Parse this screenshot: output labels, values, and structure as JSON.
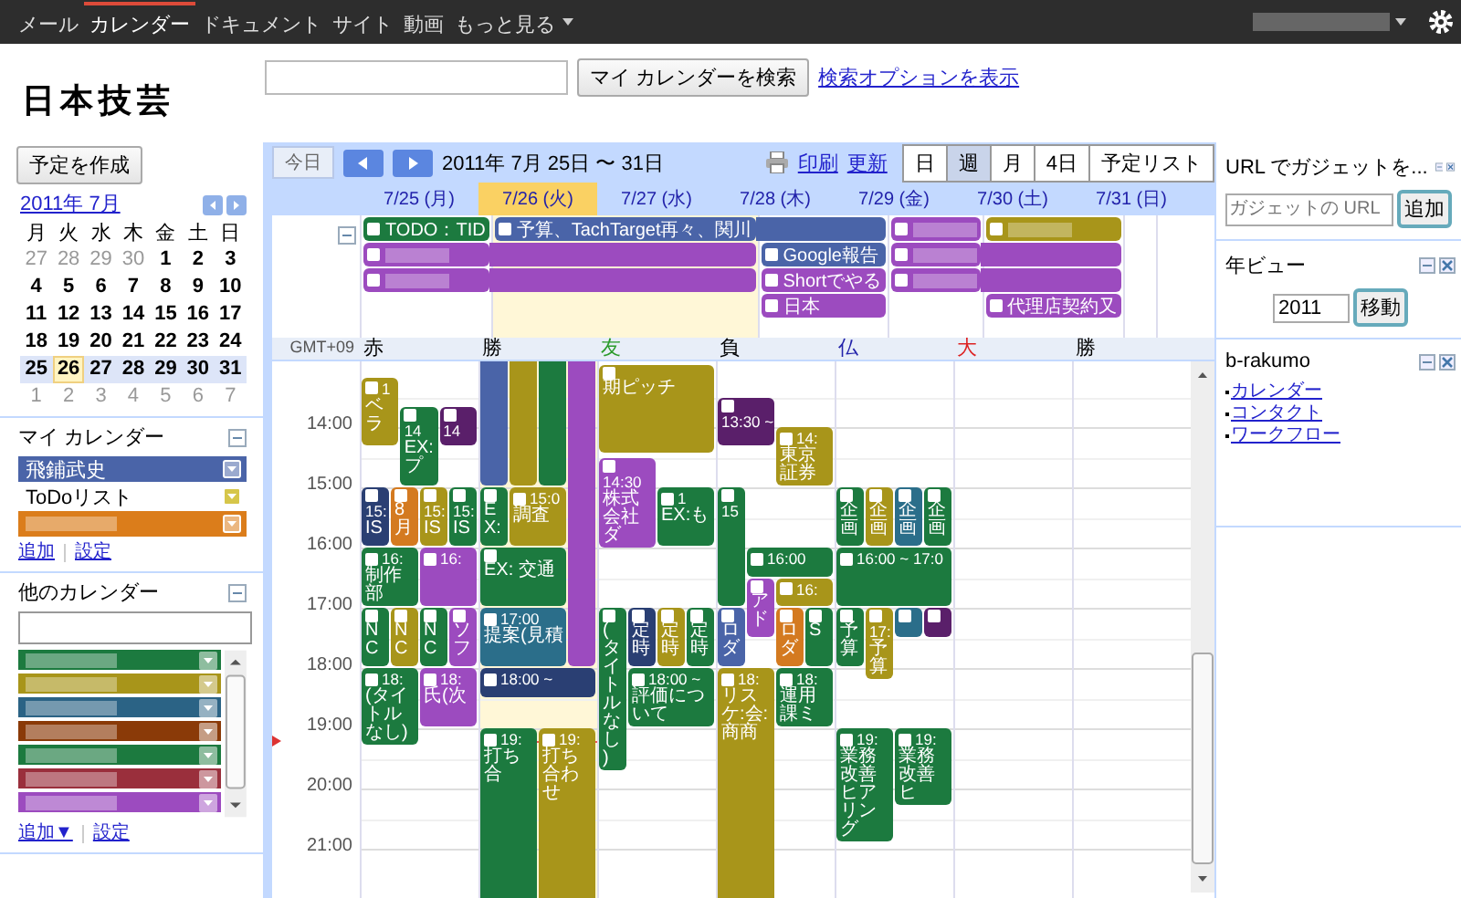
{
  "topbar": {
    "links": [
      {
        "label": "メール",
        "selected": false
      },
      {
        "label": "カレンダー",
        "selected": true
      },
      {
        "label": "ドキュメント",
        "selected": false
      },
      {
        "label": "サイト",
        "selected": false
      },
      {
        "label": "動画",
        "selected": false
      },
      {
        "label": "もっと見る",
        "selected": false
      }
    ]
  },
  "header": {
    "logo": "日本技芸",
    "search_button": "マイ カレンダーを検索",
    "search_options": "検索オプションを表示"
  },
  "sidebar": {
    "create_button": "予定を作成",
    "mini_calendar": {
      "title": "2011年 7月",
      "weekdays": [
        "月",
        "火",
        "水",
        "木",
        "金",
        "土",
        "日"
      ],
      "weeks": [
        {
          "selected": false,
          "days": [
            {
              "d": "27",
              "out": true,
              "today": false
            },
            {
              "d": "28",
              "out": true,
              "today": false
            },
            {
              "d": "29",
              "out": true,
              "today": false
            },
            {
              "d": "30",
              "out": true,
              "today": false
            },
            {
              "d": "1",
              "out": false,
              "today": false
            },
            {
              "d": "2",
              "out": false,
              "today": false
            },
            {
              "d": "3",
              "out": false,
              "today": false
            }
          ]
        },
        {
          "selected": false,
          "days": [
            {
              "d": "4",
              "out": false,
              "today": false
            },
            {
              "d": "5",
              "out": false,
              "today": false
            },
            {
              "d": "6",
              "out": false,
              "today": false
            },
            {
              "d": "7",
              "out": false,
              "today": false
            },
            {
              "d": "8",
              "out": false,
              "today": false
            },
            {
              "d": "9",
              "out": false,
              "today": false
            },
            {
              "d": "10",
              "out": false,
              "today": false
            }
          ]
        },
        {
          "selected": false,
          "days": [
            {
              "d": "11",
              "out": false,
              "today": false
            },
            {
              "d": "12",
              "out": false,
              "today": false
            },
            {
              "d": "13",
              "out": false,
              "today": false
            },
            {
              "d": "14",
              "out": false,
              "today": false
            },
            {
              "d": "15",
              "out": false,
              "today": false
            },
            {
              "d": "16",
              "out": false,
              "today": false
            },
            {
              "d": "17",
              "out": false,
              "today": false
            }
          ]
        },
        {
          "selected": false,
          "days": [
            {
              "d": "18",
              "out": false,
              "today": false
            },
            {
              "d": "19",
              "out": false,
              "today": false
            },
            {
              "d": "20",
              "out": false,
              "today": false
            },
            {
              "d": "21",
              "out": false,
              "today": false
            },
            {
              "d": "22",
              "out": false,
              "today": false
            },
            {
              "d": "23",
              "out": false,
              "today": false
            },
            {
              "d": "24",
              "out": false,
              "today": false
            }
          ]
        },
        {
          "selected": true,
          "days": [
            {
              "d": "25",
              "out": false,
              "today": false
            },
            {
              "d": "26",
              "out": false,
              "today": true
            },
            {
              "d": "27",
              "out": false,
              "today": false
            },
            {
              "d": "28",
              "out": false,
              "today": false
            },
            {
              "d": "29",
              "out": false,
              "today": false
            },
            {
              "d": "30",
              "out": false,
              "today": false
            },
            {
              "d": "31",
              "out": false,
              "today": false
            }
          ]
        },
        {
          "selected": false,
          "days": [
            {
              "d": "1",
              "out": true,
              "today": false
            },
            {
              "d": "2",
              "out": true,
              "today": false
            },
            {
              "d": "3",
              "out": true,
              "today": false
            },
            {
              "d": "4",
              "out": true,
              "today": false
            },
            {
              "d": "5",
              "out": true,
              "today": false
            },
            {
              "d": "6",
              "out": true,
              "today": false
            },
            {
              "d": "7",
              "out": true,
              "today": false
            }
          ]
        }
      ]
    },
    "my_calendars": {
      "title": "マイ カレンダー",
      "items": [
        {
          "name": "飛鋪武史",
          "color": "#4a64a8",
          "filled": true
        },
        {
          "name": "ToDoリスト",
          "color": "#d6c64a",
          "filled": false
        },
        {
          "color": "#db7d1b",
          "filled": true
        }
      ],
      "links": [
        "追加",
        "設定"
      ]
    },
    "other_calendars": {
      "title": "他のカレンダー",
      "items": [
        {
          "color": "#1c7a3f"
        },
        {
          "color": "#a8951a"
        },
        {
          "color": "#2b6385"
        },
        {
          "color": "#8a3a08"
        },
        {
          "color": "#1c7a3f"
        },
        {
          "color": "#9a2f3c"
        },
        {
          "color": "#9c4bbf"
        }
      ],
      "links": [
        "追加▼",
        "設定"
      ]
    }
  },
  "toolbar": {
    "today": "今日",
    "range": "2011年 7月 25日 〜 31日",
    "print": "印刷",
    "refresh": "更新",
    "views": [
      {
        "label": "日",
        "selected": false
      },
      {
        "label": "週",
        "selected": true
      },
      {
        "label": "月",
        "selected": false
      },
      {
        "label": "4日",
        "selected": false
      },
      {
        "label": "予定リスト",
        "selected": false
      }
    ]
  },
  "week": {
    "timezone": "GMT+09",
    "hours": [
      "14:00",
      "15:00",
      "16:00",
      "17:00",
      "18:00",
      "19:00",
      "20:00",
      "21:00"
    ],
    "days": [
      {
        "label": "7/25 (月)",
        "today": false,
        "rokuyo": {
          "text": "赤",
          "color": "#000000"
        },
        "allday": [
          {
            "kind": "event",
            "title": "TODO：TID",
            "color": "#1c7a3f",
            "continued": false
          },
          {
            "kind": "event",
            "color": "#9c4bbf",
            "continued": false
          },
          {
            "kind": "event",
            "color": "#9c4bbf",
            "continued": false
          }
        ],
        "events": [
          {
            "time": "1",
            "title": "ベラ",
            "color": "#a8951a"
          },
          {
            "time": "14",
            "title": "EX:プ",
            "color": "#1c7a3f"
          },
          {
            "time": "14",
            "color": "#5a1f6a"
          },
          {
            "time": "15:",
            "title": "IS",
            "color": "#2a3f73"
          },
          {
            "title": "8月",
            "color": "#d47a20"
          },
          {
            "time": "15:",
            "title": "IS",
            "color": "#a8951a"
          },
          {
            "time": "15:",
            "title": "IS",
            "color": "#1c7a3f"
          },
          {
            "time": "16:",
            "title": "制作部",
            "color": "#1c7a3f"
          },
          {
            "time": "16:",
            "color": "#9c4bbf"
          },
          {
            "title": "NC",
            "color": "#1c7a3f"
          },
          {
            "title": "NC",
            "color": "#a8951a"
          },
          {
            "title": "NC",
            "color": "#1c7a3f"
          },
          {
            "title": "ソフ",
            "color": "#9c4bbf"
          },
          {
            "time": "18:",
            "title": "(タイトルなし)",
            "color": "#1c7a3f"
          },
          {
            "time": "18:",
            "title": "氏(次",
            "color": "#9c4bbf"
          }
        ]
      },
      {
        "label": "7/26 (火)",
        "today": true,
        "rokuyo": {
          "text": "勝",
          "color": "#000000"
        },
        "allday": [
          {
            "kind": "event",
            "title": "予算、TachTarget再々、関川",
            "color": "#4a64a8",
            "continued": false
          },
          {
            "kind": "event",
            "color": "#9c4bbf",
            "continued": true
          },
          {
            "kind": "event",
            "color": "#9c4bbf",
            "continued": true
          }
        ],
        "events": [
          {
            "color": "#4a64a8"
          },
          {
            "color": "#a8951a"
          },
          {
            "color": "#1c7a3f"
          },
          {
            "color": "#9c4bbf"
          },
          {
            "title": "EX:",
            "color": "#1c7a3f"
          },
          {
            "time": "15:0",
            "title": "調査",
            "color": "#a8951a"
          },
          {
            "title": "EX: 交通",
            "color": "#1c7a3f"
          },
          {
            "time": "17:00",
            "title": "提案(見積",
            "color": "#2b6e8a"
          },
          {
            "time": "18:00 ~",
            "color": "#2a3f73"
          },
          {
            "time": "19:",
            "title": "打ち合",
            "color": "#1c7a3f"
          },
          {
            "time": "19:",
            "title": "打ち合わせ",
            "color": "#a8951a"
          }
        ]
      },
      {
        "label": "7/27 (水)",
        "today": false,
        "rokuyo": {
          "text": "友",
          "color": "#2a9a2a"
        },
        "allday": [
          {
            "kind": "event",
            "color": "#4a64a8",
            "continued": true
          },
          {
            "kind": "event",
            "title": "Google報告",
            "color": "#4a64a8",
            "continued": false
          },
          {
            "kind": "event",
            "title": "Shortでやる",
            "color": "#9c4bbf",
            "continued": false
          },
          {
            "kind": "event",
            "title": "日本",
            "color": "#9c4bbf",
            "continued": false
          }
        ],
        "events": [
          {
            "title": "期ピッチ",
            "color": "#a8951a"
          },
          {
            "time": "14:30",
            "title": "株式会社ダ",
            "color": "#9c4bbf"
          },
          {
            "time": "1",
            "title": "EX:も",
            "color": "#1c7a3f"
          },
          {
            "title": "(タイトルなし)",
            "color": "#1c7a3f"
          },
          {
            "title": "定時",
            "color": "#2a3f73"
          },
          {
            "title": "定時",
            "color": "#a8951a"
          },
          {
            "title": "定時",
            "color": "#1c7a3f"
          },
          {
            "time": "18:00 ~",
            "title": "評価について",
            "color": "#1c7a3f"
          }
        ]
      },
      {
        "label": "7/28 (木)",
        "today": false,
        "rokuyo": {
          "text": "負",
          "color": "#000000"
        },
        "allday": [
          {
            "kind": "event",
            "color": "#9c4bbf",
            "continued": false
          },
          {
            "kind": "event",
            "color": "#9c4bbf",
            "continued": false
          },
          {
            "kind": "event",
            "color": "#9c4bbf",
            "continued": false
          }
        ],
        "events": [
          {
            "time": "13:30 ~",
            "color": "#5a1f6a"
          },
          {
            "time": "14:",
            "title": "東京証券",
            "color": "#a8951a"
          },
          {
            "time": "15",
            "color": "#1c7a3f"
          },
          {
            "time": "16:00",
            "color": "#1c7a3f"
          },
          {
            "title": "アド",
            "color": "#9c4bbf"
          },
          {
            "time": "16:",
            "color": "#a8951a"
          },
          {
            "title": "ロダ",
            "color": "#4a64a8"
          },
          {
            "title": "ロダ",
            "color": "#d47a20"
          },
          {
            "title": "S",
            "color": "#1c7a3f"
          },
          {
            "time": "18:",
            "title": "リスケ:会:商商",
            "color": "#a8951a"
          },
          {
            "time": "18:",
            "title": "運用課ミ",
            "color": "#1c7a3f"
          }
        ]
      },
      {
        "label": "7/29 (金)",
        "today": false,
        "rokuyo": {
          "text": "仏",
          "color": "#2222aa"
        },
        "allday": [
          {
            "kind": "event",
            "color": "#a8951a",
            "continued": false
          },
          {
            "kind": "event",
            "color": "#9c4bbf",
            "continued": true
          },
          {
            "kind": "event",
            "color": "#9c4bbf",
            "continued": true
          },
          {
            "kind": "event",
            "title": "代理店契約又",
            "color": "#9c4bbf",
            "continued": false
          }
        ],
        "events": [
          {
            "title": "企画",
            "color": "#1c7a3f"
          },
          {
            "title": "企画",
            "color": "#a8951a"
          },
          {
            "title": "企画",
            "color": "#2b6e8a"
          },
          {
            "title": "企画",
            "color": "#1c7a3f"
          },
          {
            "time": "16:00 ~ 17:0",
            "color": "#1c7a3f"
          },
          {
            "title": "予算",
            "color": "#1c7a3f"
          },
          {
            "time": "17:",
            "title": "予算",
            "color": "#a8951a"
          },
          {
            "color": "#2b6e8a"
          },
          {
            "color": "#5a1f6a"
          },
          {
            "time": "19:",
            "title": "業務改善ヒアリング",
            "color": "#1c7a3f"
          },
          {
            "time": "19:",
            "title": "業務改善ヒ",
            "color": "#1c7a3f"
          }
        ]
      },
      {
        "label": "7/30 (土)",
        "today": false,
        "rokuyo": {
          "text": "大",
          "color": "#dd2222"
        }
      },
      {
        "label": "7/31 (日)",
        "today": false,
        "rokuyo": {
          "text": "勝",
          "color": "#000000"
        }
      }
    ]
  },
  "gadgets": [
    {
      "kind": "url",
      "title": "URL でガジェットを...",
      "placeholder": "ガジェットの URL",
      "button": "追加"
    },
    {
      "kind": "year",
      "title": "年ビュー",
      "value": "2011",
      "button": "移動"
    },
    {
      "kind": "links",
      "title": "b-rakumo",
      "links": [
        "カレンダー",
        "コンタクト",
        "ワークフロー"
      ]
    }
  ]
}
